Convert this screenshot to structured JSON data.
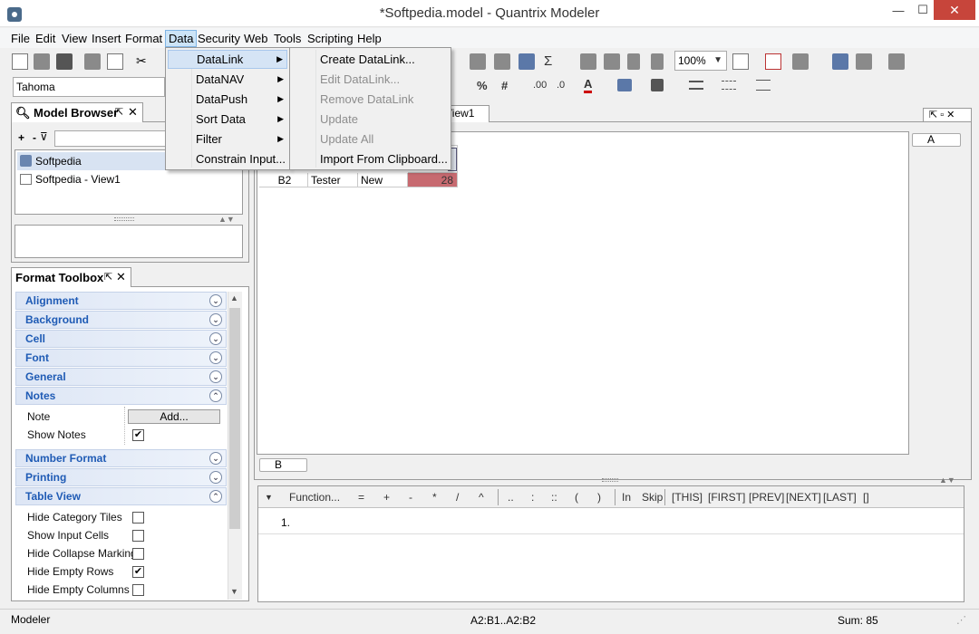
{
  "window": {
    "title": "*Softpedia.model - Quantrix Modeler",
    "minimize": "—",
    "maximize": "☐",
    "close": "✕"
  },
  "menubar": {
    "items": [
      "File",
      "Edit",
      "View",
      "Insert",
      "Format",
      "Data",
      "Security",
      "Web",
      "Tools",
      "Scripting",
      "Help"
    ]
  },
  "toolbar": {
    "zoom": "100%",
    "font": "Tahoma",
    "sigma": "Σ",
    "percent": "%",
    "hash": "#",
    "inc_dec": ".00",
    "dec_dec": ".0"
  },
  "data_menu": {
    "items": [
      {
        "label": "DataLink",
        "submenu": true
      },
      {
        "label": "DataNAV",
        "submenu": true
      },
      {
        "label": "DataPush",
        "submenu": true
      },
      {
        "label": "Sort Data",
        "submenu": true
      },
      {
        "label": "Filter",
        "submenu": true
      },
      {
        "label": "Constrain Input...",
        "submenu": false
      }
    ],
    "submenu_arrow": "▶"
  },
  "datalink_menu": {
    "items": [
      {
        "label": "Create DataLink...",
        "enabled": true
      },
      {
        "label": "Edit DataLink...",
        "enabled": false
      },
      {
        "label": "Remove DataLink",
        "enabled": false
      },
      {
        "label": "Update",
        "enabled": false
      },
      {
        "label": "Update All",
        "enabled": false
      },
      {
        "label": "Import From Clipboard...",
        "enabled": true
      }
    ]
  },
  "model_browser": {
    "title": "Model Browser",
    "tree": [
      "Softpedia",
      "Softpedia - View1"
    ],
    "add": "+",
    "minus": "-",
    "pin": "⇱",
    "close": "✕"
  },
  "view": {
    "tab": "View1",
    "category_a": "A",
    "category_b": "B"
  },
  "grid_row": {
    "cells": [
      "B2",
      "Tester",
      "New",
      "28"
    ]
  },
  "format_toolbox": {
    "title": "Format Toolbox",
    "sections": [
      "Alignment",
      "Background",
      "Cell",
      "Font",
      "General",
      "Notes",
      "Number Format",
      "Printing",
      "Table View"
    ],
    "notes": {
      "note_label": "Note",
      "add_button": "Add...",
      "show_notes": "Show Notes"
    },
    "table_view": [
      "Hide Category Tiles",
      "Show Input Cells",
      "Hide Collapse Marking",
      "Hide Empty Rows",
      "Hide Empty Columns"
    ]
  },
  "formula_bar": {
    "function": "Function...",
    "ops": [
      "=",
      "+",
      "-",
      "*",
      "/",
      "^"
    ],
    "ops2": [
      "..",
      ":",
      "::",
      "(",
      ")"
    ],
    "ops3": [
      "In",
      "Skip"
    ],
    "refs": [
      "[THIS]",
      "[FIRST]",
      "[PREV]",
      "[NEXT]",
      "[LAST]",
      "[]"
    ],
    "line": "1."
  },
  "statusbar": {
    "left": "Modeler",
    "range": "A2:B1..A2:B2",
    "sum": "Sum: 85"
  }
}
